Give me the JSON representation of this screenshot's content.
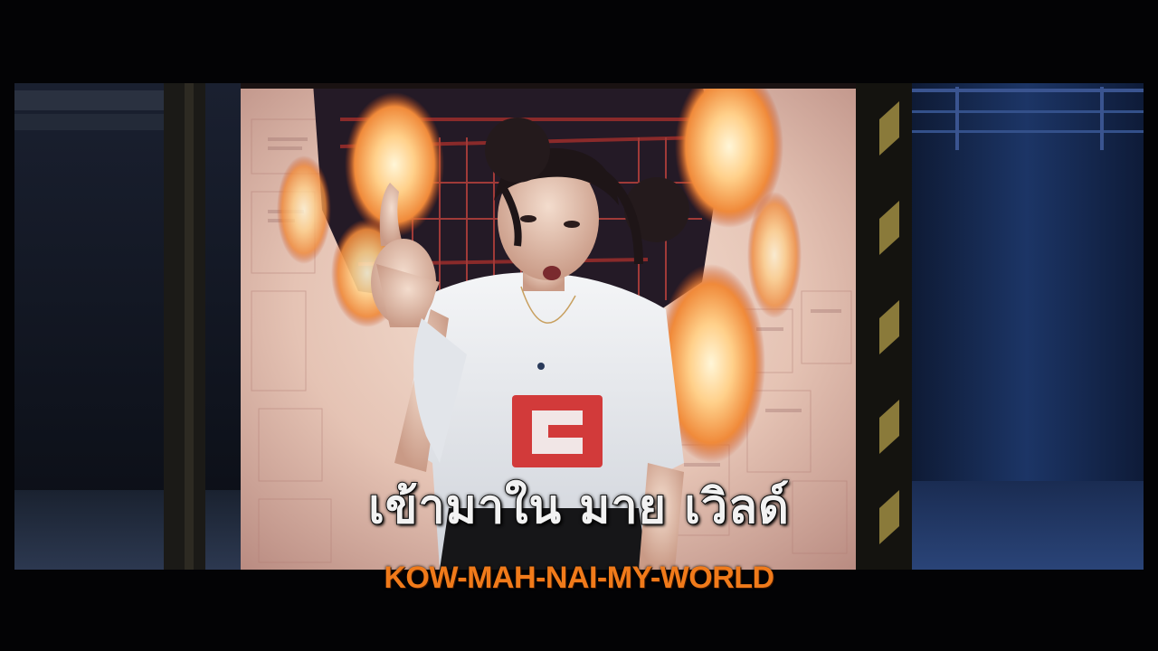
{
  "video": {
    "alt": "Music video still: performer in white t-shirt with hair buns, pointing upward, in front of a burning newspaper-covered wall",
    "colors": {
      "backdrop_left": "#0f1522",
      "backdrop_right": "#16274a",
      "paper": "#e8cdbf",
      "fire": "#ffd28a",
      "shirt": "#e9ecef",
      "shirt_logo": "#d23a3a"
    }
  },
  "subtitles": {
    "thai": "เข้ามาใน มาย เวิลด์",
    "romanized": "KOW-MAH-NAI-MY-WORLD"
  }
}
